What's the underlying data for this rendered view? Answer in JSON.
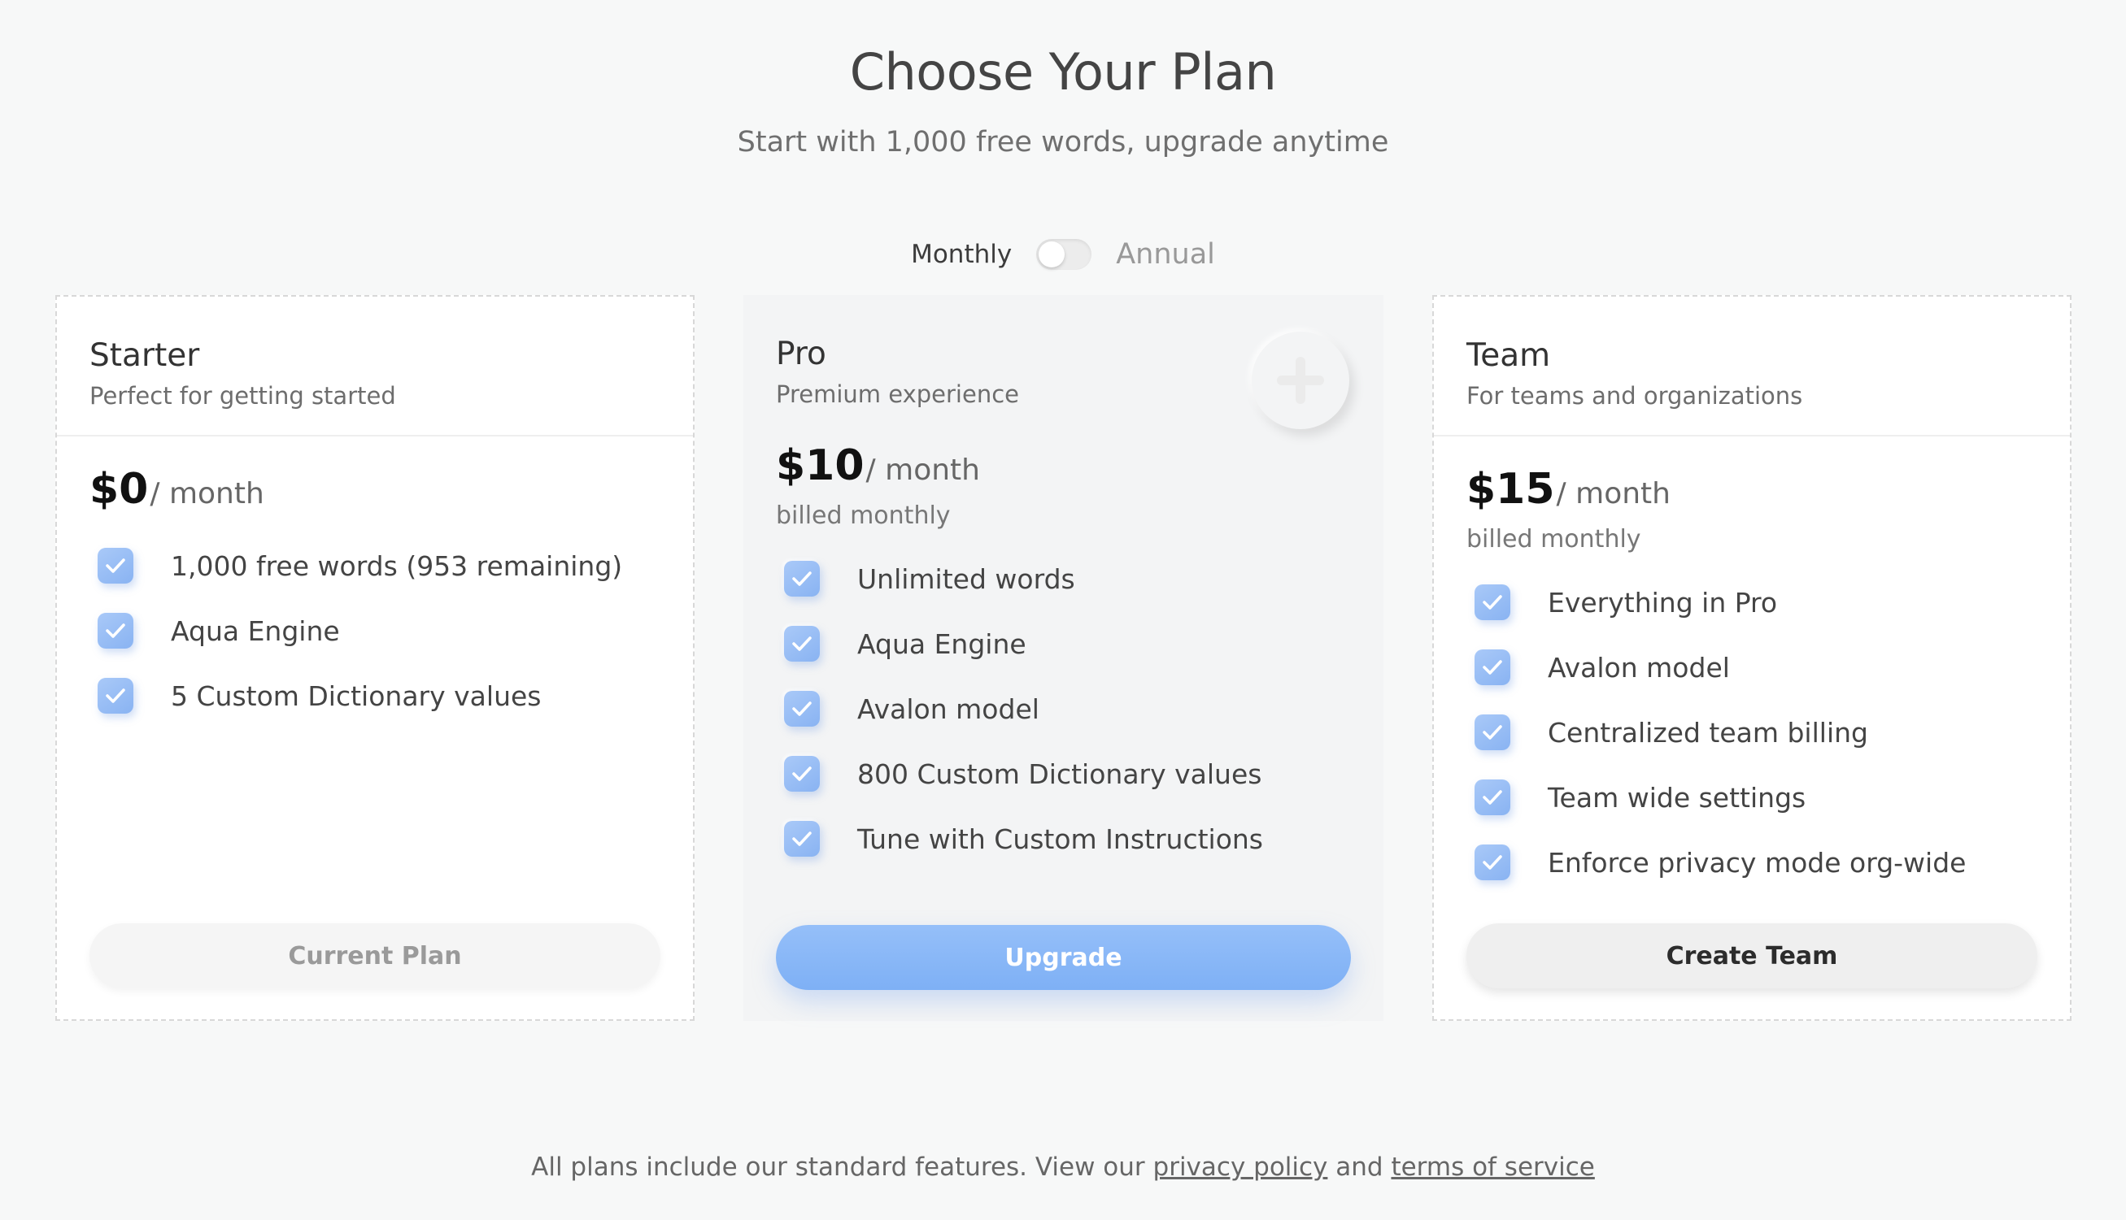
{
  "header": {
    "title": "Choose Your Plan",
    "subtitle": "Start with 1,000 free words, upgrade anytime"
  },
  "billing_toggle": {
    "monthly_label": "Monthly",
    "annual_label": "Annual",
    "annual_enabled": false
  },
  "plans": [
    {
      "name": "Starter",
      "description": "Perfect for getting started",
      "price": "$0",
      "period": "/ month",
      "billed": "",
      "features": [
        "1,000 free words (953 remaining)",
        "Aqua Engine",
        "5 Custom Dictionary values"
      ],
      "cta": "Current Plan"
    },
    {
      "name": "Pro",
      "description": "Premium experience",
      "price": "$10",
      "period": "/ month",
      "billed": "billed monthly",
      "features": [
        "Unlimited words",
        "Aqua Engine",
        "Avalon model",
        "800 Custom Dictionary values",
        "Tune with Custom Instructions"
      ],
      "cta": "Upgrade"
    },
    {
      "name": "Team",
      "description": "For teams and organizations",
      "price": "$15",
      "period": "/ month",
      "billed": "billed monthly",
      "features": [
        "Everything in Pro",
        "Avalon model",
        "Centralized team billing",
        "Team wide settings",
        "Enforce privacy mode org-wide"
      ],
      "cta": "Create Team"
    }
  ],
  "footer": {
    "text_before": "All plans include our standard features. View our ",
    "privacy_link": "privacy policy",
    "text_middle": " and ",
    "terms_link": "terms of service"
  },
  "colors": {
    "accent": "#8ab6f6",
    "background": "#f7f8f8"
  },
  "icons": {
    "check": "check-icon",
    "pro_badge": "plus-icon"
  }
}
